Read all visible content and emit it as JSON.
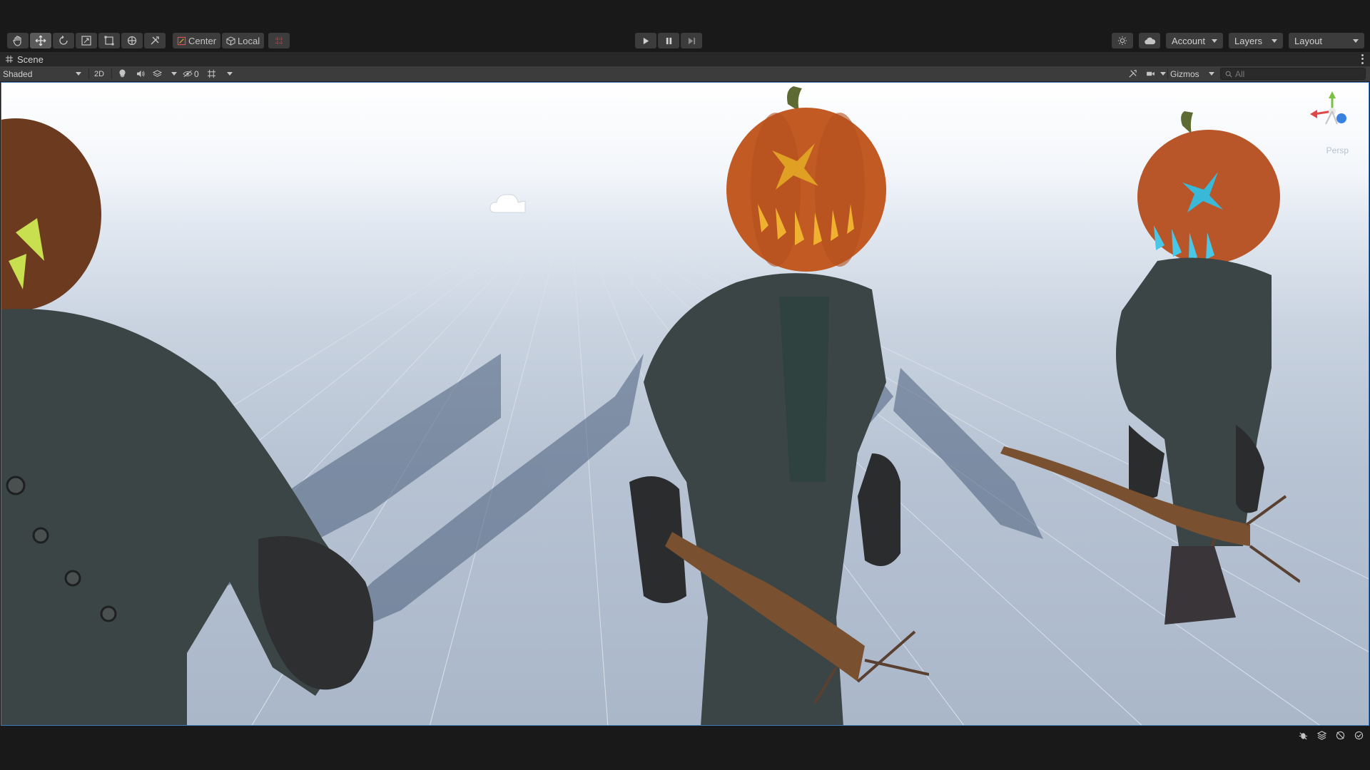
{
  "toolbar": {
    "tools": [
      {
        "name": "hand-tool",
        "icon": "hand-icon",
        "active": false
      },
      {
        "name": "move-tool",
        "icon": "move-icon",
        "active": true
      },
      {
        "name": "rotate-tool",
        "icon": "rotate-icon",
        "active": false
      },
      {
        "name": "scale-tool",
        "icon": "scale-icon",
        "active": false
      },
      {
        "name": "rect-tool",
        "icon": "rect-icon",
        "active": false
      },
      {
        "name": "transform-tool",
        "icon": "transform-icon",
        "active": false
      },
      {
        "name": "custom-tool",
        "icon": "tools-icon",
        "active": false
      }
    ],
    "pivot_label": "Center",
    "space_label": "Local",
    "account_label": "Account",
    "layers_label": "Layers",
    "layout_label": "Layout"
  },
  "tab": {
    "title": "Scene"
  },
  "scene_toolbar": {
    "draw_mode": "Shaded",
    "mode_2d": "2D",
    "hidden_count": "0",
    "gizmos_label": "Gizmos",
    "search_placeholder": "All"
  },
  "viewport": {
    "projection_label": "Persp",
    "accent": "#3a79bb"
  }
}
